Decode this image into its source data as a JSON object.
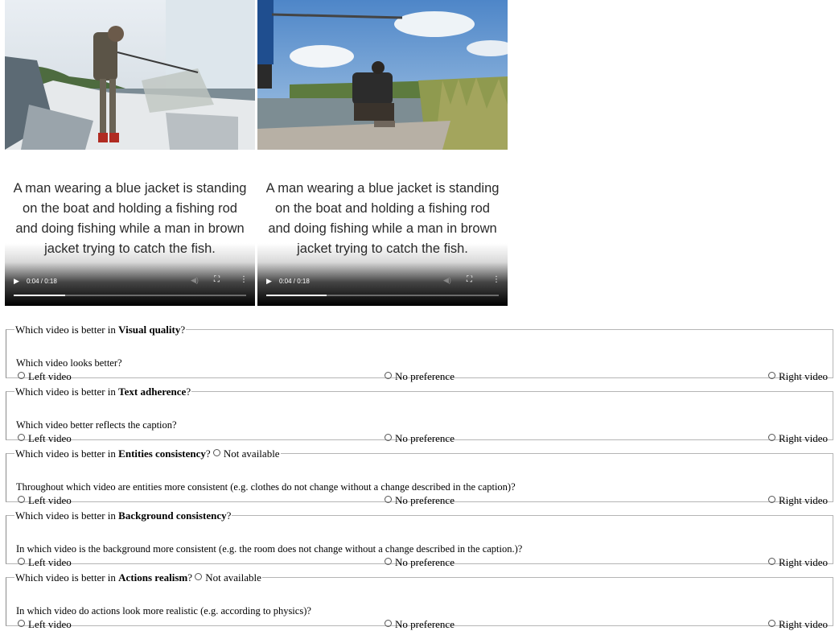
{
  "videos": [
    {
      "side": "left",
      "caption": "A man wearing a blue jacket is standing on the boat and holding a fishing rod and doing fishing while a man in brown jacket trying to catch the fish.",
      "time": "0:04 / 0:18",
      "progress": 0.22
    },
    {
      "side": "right",
      "caption": "A man wearing a blue jacket is standing on the boat and holding a fishing rod and doing fishing while a man in brown jacket trying to catch the fish.",
      "time": "0:04 / 0:18",
      "progress": 0.26
    }
  ],
  "legend_prefix": "Which video is better in ",
  "not_available": "Not available",
  "options": {
    "left": "Left video",
    "none": "No preference",
    "right": "Right video"
  },
  "questions": [
    {
      "criterion": "Visual quality",
      "suffix": "?",
      "has_na": false,
      "prompt": "Which video looks better?"
    },
    {
      "criterion": "Text adherence",
      "suffix": "?",
      "has_na": false,
      "prompt": "Which video better reflects the caption?"
    },
    {
      "criterion": "Entities consistency",
      "suffix": "?",
      "has_na": true,
      "prompt": "Throughout which video are entities more consistent (e.g. clothes do not change without a change described in the caption)?"
    },
    {
      "criterion": "Background consistency",
      "suffix": "?",
      "has_na": false,
      "prompt": "In which video is the background more consistent (e.g. the room does not change without a change described in the caption.)?"
    },
    {
      "criterion": "Actions realism",
      "suffix": "?",
      "has_na": true,
      "prompt": "In which video do actions look more realistic (e.g. according to physics)?"
    }
  ]
}
